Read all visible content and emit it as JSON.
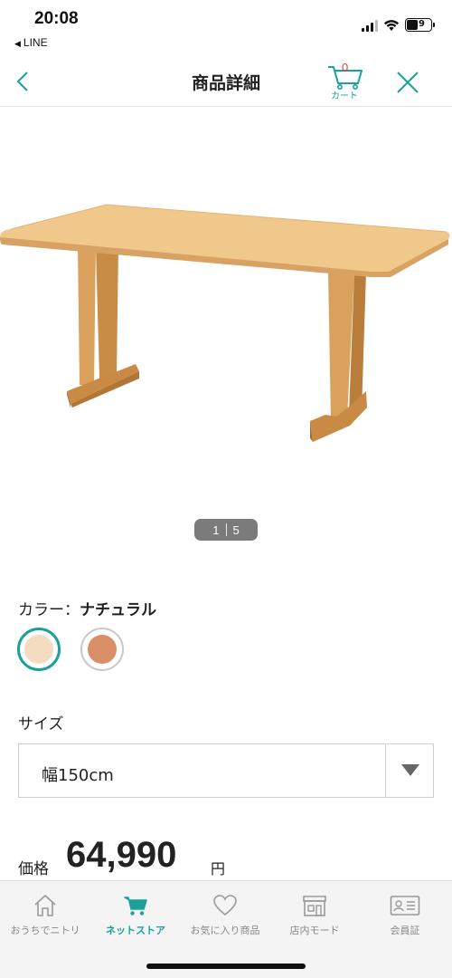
{
  "status_bar": {
    "time": "20:08",
    "back_app": "LINE",
    "battery": "29"
  },
  "nav": {
    "title": "商品詳細",
    "cart_count": "0",
    "cart_label": "カート"
  },
  "gallery": {
    "current": "1",
    "total": "5"
  },
  "color": {
    "label": "カラー：",
    "selected": "ナチュラル",
    "swatches": [
      {
        "name": "natural",
        "hex": "#f3dcc0",
        "selected": true
      },
      {
        "name": "brown",
        "hex": "#d98f68",
        "selected": false
      }
    ]
  },
  "size": {
    "label": "サイズ",
    "selected": "幅150cm"
  },
  "price": {
    "label": "価格",
    "value": "64,990",
    "unit": "円"
  },
  "tabbar": {
    "items": [
      {
        "label": "おうちでニトリ",
        "icon": "home-icon",
        "active": false
      },
      {
        "label": "ネットストア",
        "icon": "cart-icon",
        "active": true
      },
      {
        "label": "お気に入り商品",
        "icon": "heart-icon",
        "active": false
      },
      {
        "label": "店内モード",
        "icon": "store-icon",
        "active": false
      },
      {
        "label": "会員証",
        "icon": "member-card-icon",
        "active": false
      }
    ]
  },
  "colors": {
    "accent": "#1aa19c",
    "cart_count": "#e03c3c"
  }
}
